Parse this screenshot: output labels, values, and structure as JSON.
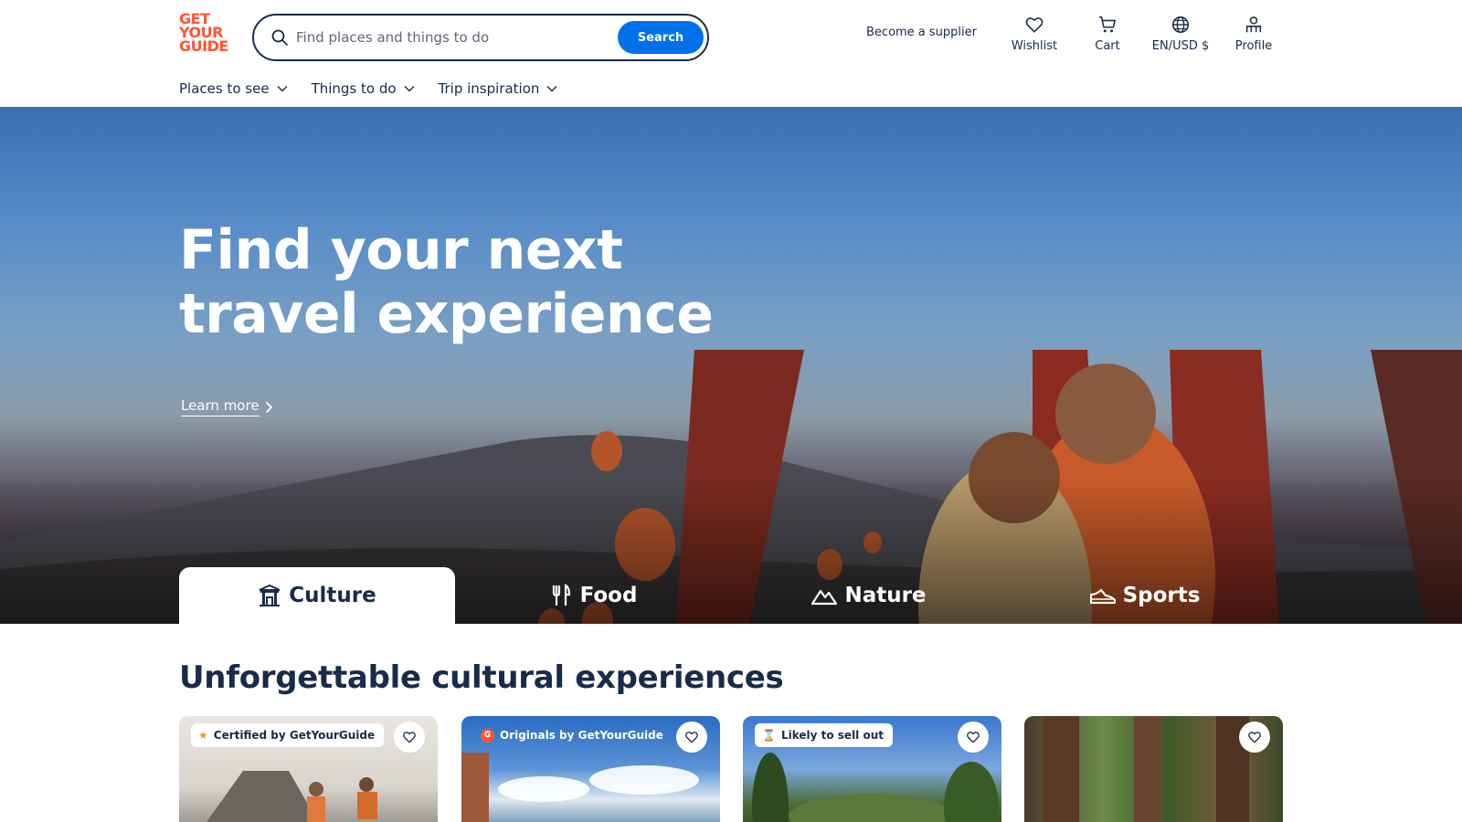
{
  "header": {
    "logo_lines": [
      "GET",
      "YOUR",
      "GUIDE"
    ],
    "search": {
      "placeholder": "Find places and things to do",
      "button_label": "Search"
    },
    "supplier_link": "Become a supplier",
    "nav": [
      {
        "label": "Wishlist",
        "icon": "heart-icon"
      },
      {
        "label": "Cart",
        "icon": "cart-icon"
      },
      {
        "label": "EN/USD $",
        "icon": "globe-icon"
      },
      {
        "label": "Profile",
        "icon": "profile-icon"
      }
    ],
    "subnav": [
      {
        "label": "Places to see"
      },
      {
        "label": "Things to do"
      },
      {
        "label": "Trip inspiration"
      }
    ]
  },
  "hero": {
    "title": "Find your next travel experience",
    "learn_more": "Learn more",
    "tabs": [
      {
        "label": "Culture",
        "icon": "temple-icon",
        "active": true
      },
      {
        "label": "Food",
        "icon": "fork-knife-icon",
        "active": false
      },
      {
        "label": "Nature",
        "icon": "mountain-icon",
        "active": false
      },
      {
        "label": "Sports",
        "icon": "shoe-icon",
        "active": false
      }
    ]
  },
  "section": {
    "title": "Unforgettable cultural experiences",
    "cards": [
      {
        "badge": "Certified by GetYourGuide",
        "badge_icon": "medal-icon"
      },
      {
        "badge": "Originals by GetYourGuide",
        "badge_icon": "gyg-originals-icon"
      },
      {
        "badge": "Likely to sell out",
        "badge_icon": "hourglass-icon"
      },
      {
        "badge": "",
        "badge_icon": ""
      }
    ]
  },
  "colors": {
    "brand": "#ff5533",
    "primary_button": "#0071eb",
    "text": "#1a2b49"
  }
}
